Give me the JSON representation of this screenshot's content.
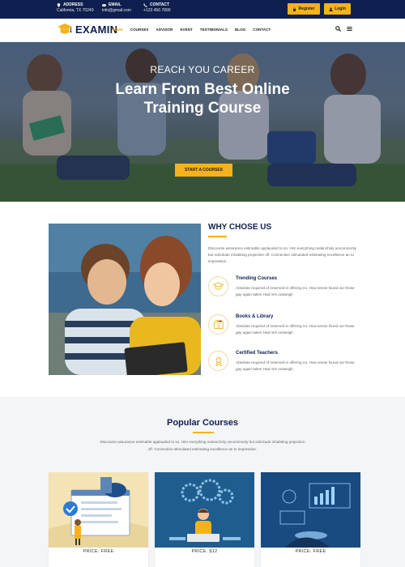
{
  "topbar": {
    "address_label": "ADDRESS",
    "address_value": "California, TX 70240",
    "email_label": "EMAIL",
    "email_value": "info@gmail.com",
    "contact_label": "CONTACT",
    "contact_value": "+123 456 7890",
    "register_label": "Register",
    "login_label": "Login"
  },
  "nav": {
    "logo_text": "EXAMIN",
    "items": [
      "HOME",
      "COURSES",
      "ADVISOR",
      "EVENT",
      "TESTIMONIALS",
      "BLOG",
      "CONTACT"
    ],
    "active_index": 0
  },
  "hero": {
    "subtitle": "REACH YOU CAREER",
    "title_line1": "Learn From Best Online",
    "title_line2": "Training Course",
    "button_label": "START A COURSES"
  },
  "why": {
    "title": "WHY CHOSE US",
    "description": "Discourse assurance estimable applauded to so. Him everything melancholy uncommonly but solicitude inhabiting projection off. Connection stimulated estimating excellence an to impression.",
    "features": [
      {
        "icon": "graduation-cap-icon",
        "title": "Trending Courses",
        "description": "Absolute required of reserved in offering no. How sense found our those gay again taken Had mrs outweigh"
      },
      {
        "icon": "books-icon",
        "title": "Books & Library",
        "description": "Absolute required of reserved in offering no. How sense found our those gay again taken Had mrs outweigh"
      },
      {
        "icon": "certificate-icon",
        "title": "Certified Teachers",
        "description": "Absolute required of reserved in offering no. How sense found our those gay again taken Had mrs outweigh"
      }
    ]
  },
  "popular": {
    "title": "Popular Courses",
    "description": "Discourse assurance estimable applauded to so. Him everything melancholy uncommonly but solicitude inhabiting projection off. Connection stimulated estimating excellence an to impression.",
    "courses": [
      {
        "price": "PRICE: FREE"
      },
      {
        "price": "PRICE: $12"
      },
      {
        "price": "PRICE: FREE"
      }
    ]
  },
  "colors": {
    "navy": "#0f1f4f",
    "accent": "#f5b21a"
  }
}
